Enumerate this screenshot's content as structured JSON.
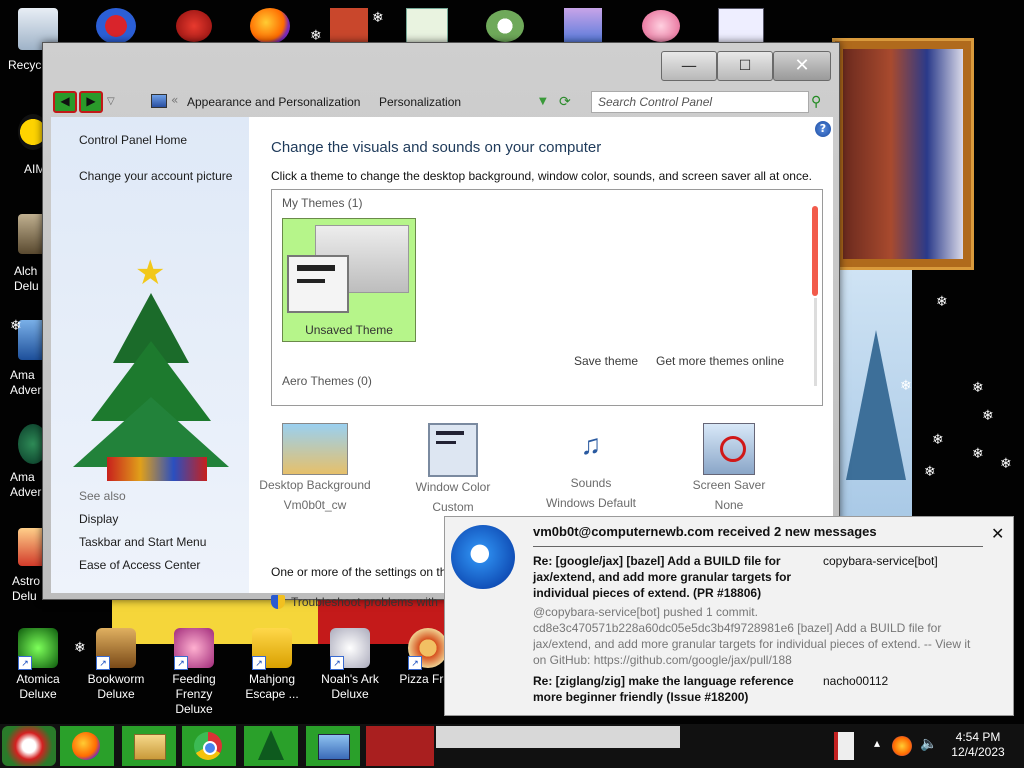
{
  "desktop": {
    "icons_left": [
      {
        "label": "Recyc",
        "icon": "recycle-bin-icon"
      },
      {
        "label": "AIM",
        "icon": "aim-icon"
      },
      {
        "label": "Alch",
        "label2": "Delu",
        "icon": "alchemy-icon"
      },
      {
        "label": "Ama",
        "label2": "Adver",
        "icon": "amazing-adventures-icon"
      },
      {
        "label": "Ama",
        "label2": "Adver",
        "icon": "amazing-adventures-2-icon"
      },
      {
        "label": "Astro",
        "label2": "Delu",
        "icon": "astro-icon"
      }
    ],
    "icons_bottom": [
      {
        "label": "Atomica",
        "label2": "Deluxe",
        "icon": "atomica-icon"
      },
      {
        "label": "Bookworm",
        "label2": "Deluxe",
        "icon": "bookworm-icon"
      },
      {
        "label": "Feeding",
        "label2": "Frenzy Deluxe",
        "icon": "feeding-frenzy-icon"
      },
      {
        "label": "Mahjong",
        "label2": "Escape ...",
        "icon": "mahjong-icon"
      },
      {
        "label": "Noah's Ark",
        "label2": "Deluxe",
        "icon": "noahs-ark-icon"
      },
      {
        "label": "Pizza Fren",
        "label2": "",
        "icon": "pizza-frenzy-icon"
      }
    ]
  },
  "window": {
    "minimize": "—",
    "maximize": "☐",
    "close": "✕",
    "breadcrumb": [
      "Appearance and Personalization",
      "Personalization"
    ],
    "search_placeholder": "Search Control Panel",
    "sidebar": {
      "home": "Control Panel Home",
      "account_picture": "Change your account picture",
      "see_also": "See also",
      "links": [
        "Display",
        "Taskbar and Start Menu",
        "Ease of Access Center"
      ]
    },
    "main": {
      "heading": "Change the visuals and sounds on your computer",
      "subheading": "Click a theme to change the desktop background, window color, sounds, and screen saver all at once.",
      "my_themes": "My Themes (1)",
      "unsaved_theme": "Unsaved Theme",
      "save_theme": "Save theme",
      "get_more": "Get more themes online",
      "aero_themes": "Aero Themes (0)",
      "settings": [
        {
          "title": "Desktop Background",
          "value": "Vm0b0t_cw"
        },
        {
          "title": "Window Color",
          "value": "Custom"
        },
        {
          "title": "Sounds",
          "value": "Windows Default"
        },
        {
          "title": "Screen Saver",
          "value": "None"
        }
      ],
      "warning": "One or more of the settings on th",
      "troubleshoot": "Troubleshoot problems with"
    }
  },
  "notification": {
    "title": "vm0b0t@computernewb.com received 2 new messages",
    "close": "✕",
    "messages": [
      {
        "subject": "Re: [google/jax] [bazel] Add a BUILD file for jax/extend, and add more granular targets for individual pieces of extend. (PR #18806)",
        "sender": "copybara-service[bot]",
        "preview": "@copybara-service[bot] pushed 1 commit. cd8e3c470571b228a60dc05e5dc3b4f9728981e6 [bazel] Add a BUILD file for jax/extend, and add more granular targets for individual pieces of extend. -- View it on GitHub: https://github.com/google/jax/pull/188"
      },
      {
        "subject": "Re: [ziglang/zig] make the language reference more beginner friendly (Issue #18200)",
        "sender": "nacho00112",
        "preview": ""
      }
    ]
  },
  "taskbar": {
    "time": "4:54 PM",
    "date": "12/4/2023"
  }
}
